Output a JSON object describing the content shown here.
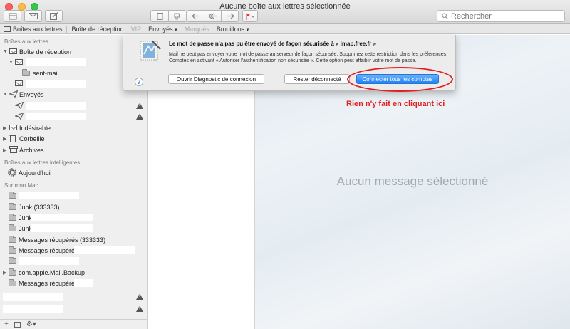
{
  "window": {
    "title": "Aucune boîte aux lettres sélectionnée"
  },
  "toolbar": {
    "search_placeholder": "Rechercher",
    "flag_color": "#e23b2a"
  },
  "favorites": {
    "mailboxes_label": "Boîtes aux lettres",
    "items": [
      "Boîte de réception",
      "VIP",
      "Envoyés",
      "Marqués",
      "Brouillons"
    ]
  },
  "sidebar": {
    "section_mailboxes": "Boîtes aux lettres",
    "inbox": "Boîte de réception",
    "sent_mail": "sent-mail",
    "sent": "Envoyés",
    "junk": "Indésirable",
    "trash": "Corbeille",
    "archives": "Archives",
    "section_smart": "Boîtes aux lettres intelligentes",
    "today": "Aujourd'hui",
    "section_onmac": "Sur mon Mac",
    "local": [
      "Junk (333333)",
      "Junk",
      "Junk",
      "Messages récupérés (333333)",
      "Messages récupérés",
      "com.apple.Mail.Backup",
      "Messages récupérés"
    ]
  },
  "message_view": {
    "empty_text": "Aucun message sélectionné"
  },
  "alert": {
    "title": "Le mot de passe n'a pas pu être envoyé de façon sécurisée à « imap.free.fr »",
    "message": "Mail ne peut pas envoyer votre mot de passe au serveur de façon sécurisée. Supprimez cette restriction dans les préférences Comptes en activant « Autoriser l'authentification non sécurisée ». Cette option peut affaiblir votre mot de passe.",
    "help": "?",
    "btn_diagnostic": "Ouvrir Diagnostic de connexion",
    "btn_stay": "Rester déconnecté",
    "btn_connect": "Connecter tous les comptes"
  },
  "annotation": {
    "text": "Rien n'y fait en cliquant ici",
    "color": "#e31e1e"
  }
}
